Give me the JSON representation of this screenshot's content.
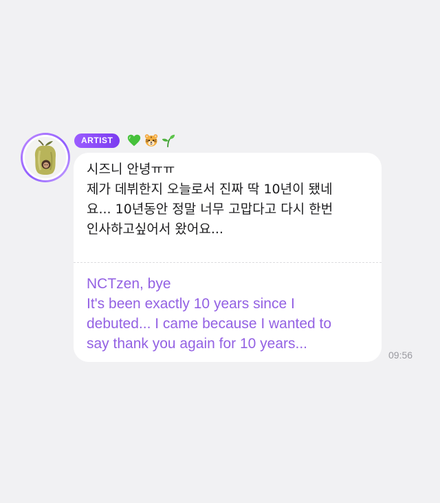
{
  "message": {
    "badge": "ARTIST",
    "emojis": [
      "green-heart",
      "tiger-face",
      "seedling"
    ],
    "korean_text": "시즈니 안녕ㅠㅠ\n제가 데뷔한지 오늘로서 진짜 딱 10년이 됐네\n요... 10년동안 정말 너무 고맙다고 다시 한번\n인사하고싶어서 왔어요...",
    "translation": "NCTzen, bye\nIt's been exactly 10 years since I\ndebuted... I came because I wanted to\nsay thank you again for 10 years...",
    "time": "09:56"
  },
  "colors": {
    "background": "#f1f1f3",
    "bubble": "#ffffff",
    "badge": "#8a4cf6",
    "translation_text": "#9361e3",
    "timestamp": "#9a9aa0"
  }
}
